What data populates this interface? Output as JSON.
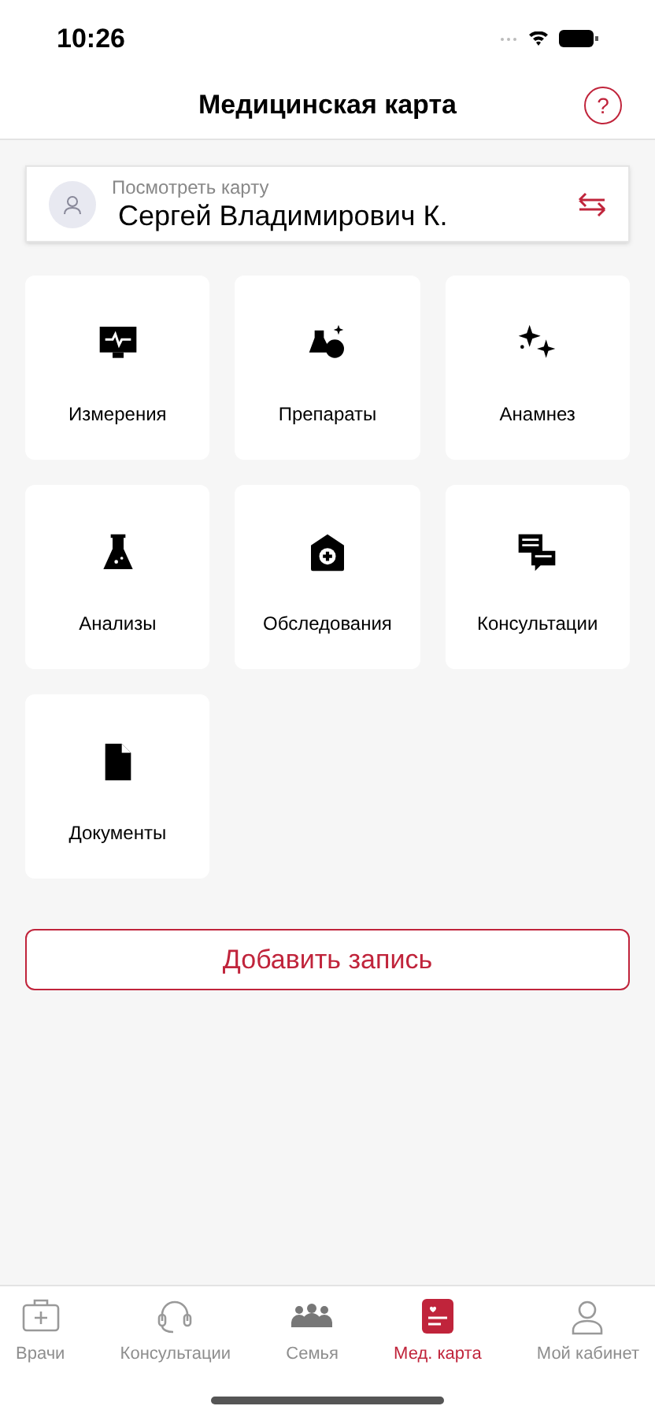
{
  "status_bar": {
    "time": "10:26"
  },
  "header": {
    "title": "Медицинская карта",
    "help_label": "?"
  },
  "patient_card": {
    "caption": "Посмотреть карту",
    "name": "Сергей Владимирович К."
  },
  "tiles": [
    {
      "label": "Измерения"
    },
    {
      "label": "Препараты"
    },
    {
      "label": "Анамнез"
    },
    {
      "label": "Анализы"
    },
    {
      "label": "Обследования"
    },
    {
      "label": "Консультации"
    },
    {
      "label": "Документы"
    }
  ],
  "add_button": {
    "label": "Добавить запись"
  },
  "tab_bar": [
    {
      "label": "Врачи",
      "selected": false
    },
    {
      "label": "Консультации",
      "selected": false
    },
    {
      "label": "Семья",
      "selected": false
    },
    {
      "label": "Мед. карта",
      "selected": true
    },
    {
      "label": "Мой кабинет",
      "selected": false
    }
  ]
}
